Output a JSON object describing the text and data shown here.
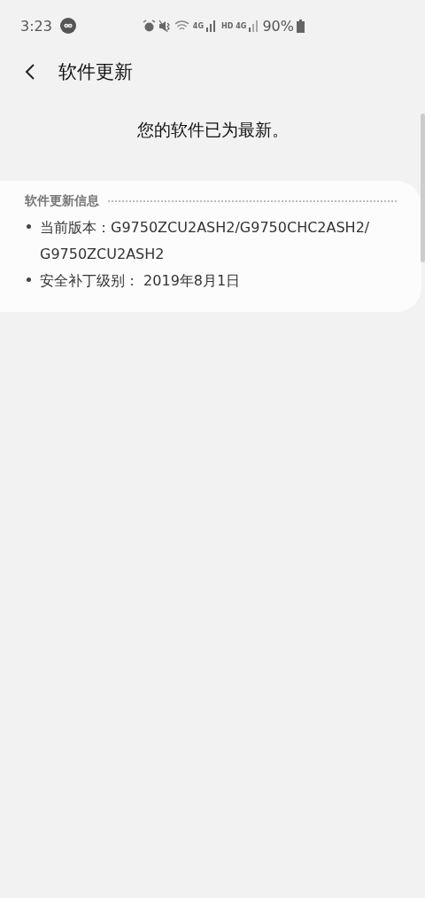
{
  "status_bar": {
    "time": "3:23",
    "network_1": "4G",
    "hd": "HD",
    "network_2": "4G",
    "battery": "90%"
  },
  "header": {
    "title": "软件更新"
  },
  "message": "您的软件已为最新。",
  "info_card": {
    "heading": "软件更新信息",
    "items": [
      "当前版本：G9750ZCU2ASH2/G9750CHC2ASH2/G9750ZCU2ASH2",
      "安全补丁级别： 2019年8月1日"
    ]
  }
}
